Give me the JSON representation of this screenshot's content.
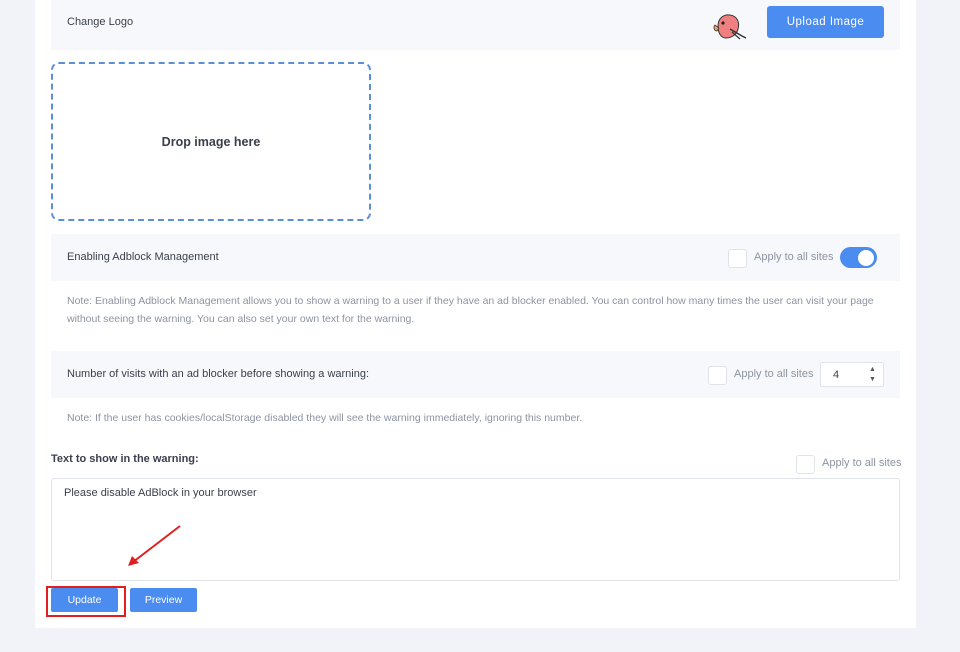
{
  "logo_section": {
    "label": "Change Logo",
    "upload_button": "Upload Image",
    "logo_icon": "parrot-logo-icon",
    "dropzone_text": "Drop image here"
  },
  "adblock": {
    "label": "Enabling Adblock Management",
    "apply_label": "Apply to all sites",
    "enabled": true,
    "note_line1": "Note: Enabling Adblock Management allows you to show a warning to a user if they have an ad blocker enabled. You can control how many times the user can visit your page",
    "note_line2": "without seeing the warning. You can also set your own text for the warning."
  },
  "visits": {
    "label": "Number of visits with an ad blocker before showing a warning:",
    "apply_label": "Apply to all sites",
    "value": "4",
    "note": "Note: If the user has cookies/localStorage disabled they will see the warning immediately, ignoring this number."
  },
  "warning_text": {
    "title": "Text to show in the warning:",
    "apply_label": "Apply to all sites",
    "value": "Please disable AdBlock in your browser"
  },
  "actions": {
    "update": "Update",
    "preview": "Preview"
  },
  "colors": {
    "accent": "#4a8cf0",
    "highlight": "#e02020"
  }
}
